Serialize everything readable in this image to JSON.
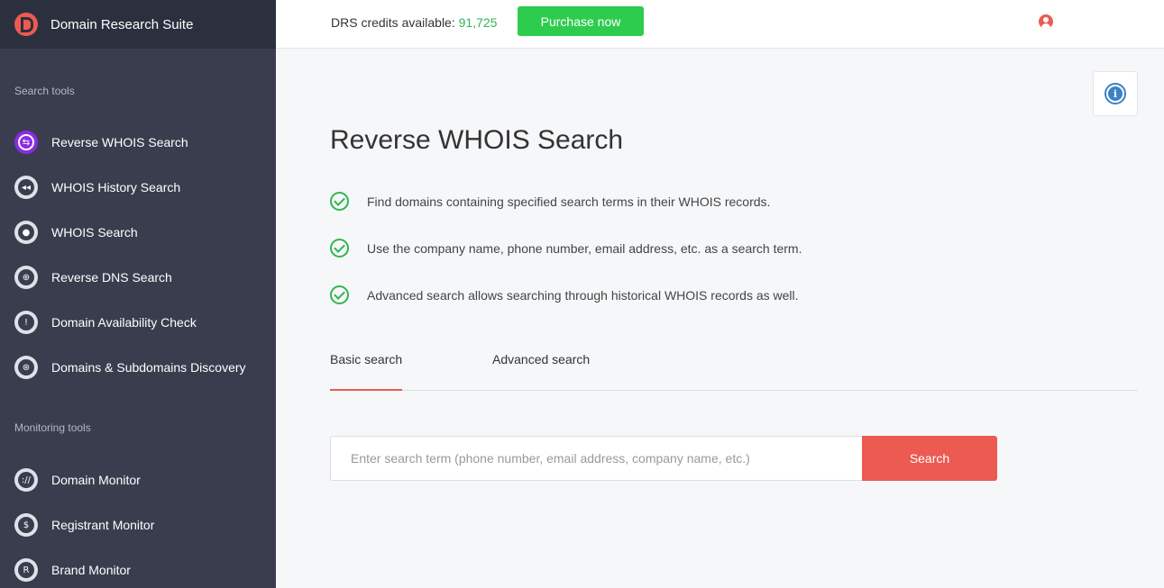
{
  "brand": {
    "title": "Domain Research Suite"
  },
  "header": {
    "credits_label": "DRS credits available:",
    "credits_value": "91,725",
    "purchase_label": "Purchase now"
  },
  "sidebar": {
    "search_tools_title": "Search tools",
    "search_items": [
      {
        "label": "Reverse WHOIS Search",
        "icon": "reverse-whois-icon",
        "active": true
      },
      {
        "label": "WHOIS History Search",
        "icon": "history-icon"
      },
      {
        "label": "WHOIS Search",
        "icon": "person-icon"
      },
      {
        "label": "Reverse DNS Search",
        "icon": "globe-icon"
      },
      {
        "label": "Domain Availability Check",
        "icon": "exclamation-icon"
      },
      {
        "label": "Domains & Subdomains Discovery",
        "icon": "www-icon"
      }
    ],
    "monitoring_tools_title": "Monitoring tools",
    "monitoring_items": [
      {
        "label": "Domain Monitor",
        "icon": "domain-monitor-icon"
      },
      {
        "label": "Registrant Monitor",
        "icon": "registrant-icon"
      },
      {
        "label": "Brand Monitor",
        "icon": "registered-icon"
      }
    ]
  },
  "main": {
    "title": "Reverse WHOIS Search",
    "features": [
      "Find domains containing specified search terms in their WHOIS records.",
      "Use the company name, phone number, email address, etc. as a search term.",
      "Advanced search allows searching through historical WHOIS records as well."
    ],
    "tabs": [
      {
        "label": "Basic search",
        "active": true
      },
      {
        "label": "Advanced search"
      }
    ],
    "search": {
      "placeholder": "Enter search term (phone number, email address, company name, etc.)",
      "value": "",
      "button_label": "Search"
    }
  },
  "colors": {
    "accent": "#ec5a52",
    "success": "#2ecc4e",
    "sidebar_bg": "#3a3d4e",
    "active_icon": "#8a2be2"
  }
}
